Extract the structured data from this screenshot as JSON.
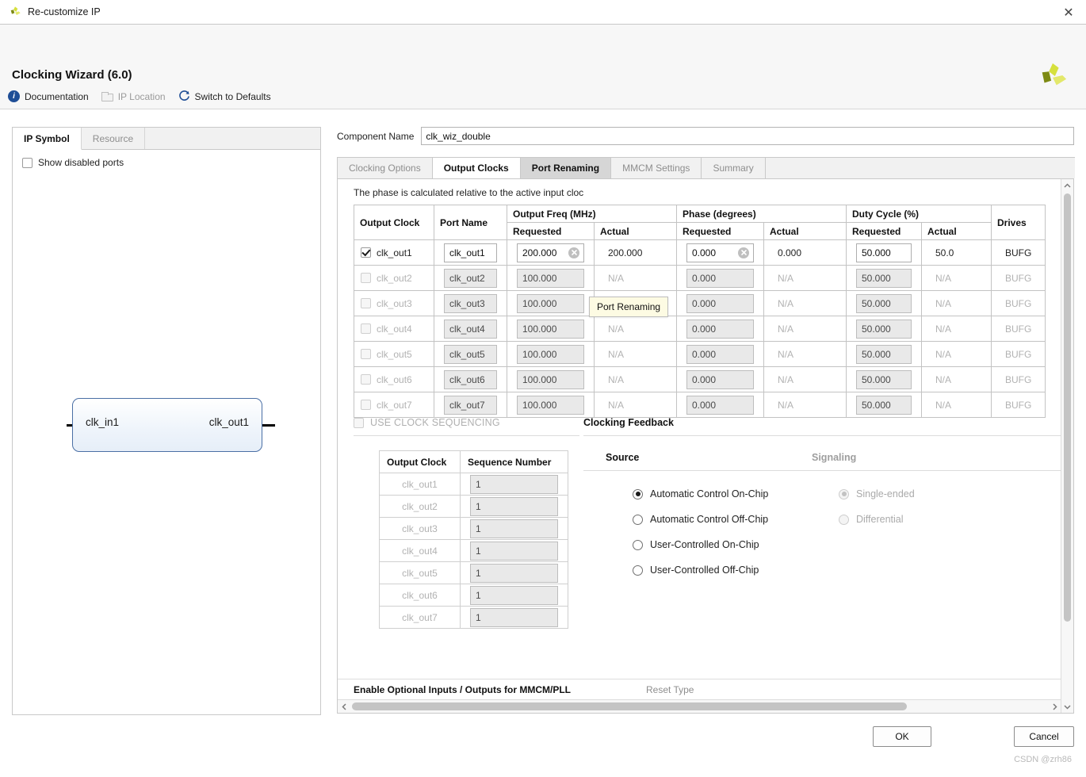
{
  "window": {
    "title": "Re-customize IP",
    "close_label": "✕"
  },
  "header": {
    "title": "Clocking Wizard (6.0)",
    "links": [
      {
        "label": "Documentation",
        "icon": "info-icon",
        "enabled": true
      },
      {
        "label": "IP Location",
        "icon": "folder-icon",
        "enabled": false
      },
      {
        "label": "Switch to Defaults",
        "icon": "refresh-icon",
        "enabled": true
      }
    ],
    "logo": "xilinx-logo"
  },
  "left_panel": {
    "tabs": [
      {
        "label": "IP Symbol",
        "active": true
      },
      {
        "label": "Resource",
        "active": false
      }
    ],
    "show_disabled_ports": {
      "label": "Show disabled ports",
      "checked": false
    },
    "symbol": {
      "input_port": "clk_in1",
      "output_port": "clk_out1"
    }
  },
  "component": {
    "label": "Component Name",
    "value": "clk_wiz_double"
  },
  "tabs": [
    {
      "label": "Clocking Options",
      "state": "inactive"
    },
    {
      "label": "Output Clocks",
      "state": "active"
    },
    {
      "label": "Port Renaming",
      "state": "hover"
    },
    {
      "label": "MMCM Settings",
      "state": "inactive"
    },
    {
      "label": "Summary",
      "state": "inactive"
    }
  ],
  "tooltip": {
    "text": "Port Renaming"
  },
  "note": "The phase is calculated relative to the active input cloc",
  "clock_table": {
    "group_headers": [
      {
        "label": "Output Clock",
        "rowspan": 2
      },
      {
        "label": "Port Name",
        "rowspan": 2
      },
      {
        "label": "Output Freq (MHz)",
        "colspan": 2
      },
      {
        "label": "Phase (degrees)",
        "colspan": 2
      },
      {
        "label": "Duty Cycle (%)",
        "colspan": 2
      },
      {
        "label": "Drives",
        "rowspan": 2
      }
    ],
    "sub_headers": [
      "Requested",
      "Actual",
      "Requested",
      "Actual",
      "Requested",
      "Actual"
    ],
    "rows": [
      {
        "name": "clk_out1",
        "checked": true,
        "enabled": true,
        "port_name": "clk_out1",
        "freq_requested": "200.000",
        "freq_actual": "200.000",
        "phase_requested": "0.000",
        "phase_actual": "0.000",
        "duty_requested": "50.000",
        "duty_actual": "50.0",
        "drives": "BUFG",
        "clear_icons": [
          "freq",
          "phase"
        ]
      },
      {
        "name": "clk_out2",
        "checked": false,
        "enabled": false,
        "port_name": "clk_out2",
        "freq_requested": "100.000",
        "freq_actual": "N/A",
        "phase_requested": "0.000",
        "phase_actual": "N/A",
        "duty_requested": "50.000",
        "duty_actual": "N/A",
        "drives": "BUFG",
        "clear_icons": []
      },
      {
        "name": "clk_out3",
        "checked": false,
        "enabled": false,
        "port_name": "clk_out3",
        "freq_requested": "100.000",
        "freq_actual": "N/A",
        "phase_requested": "0.000",
        "phase_actual": "N/A",
        "duty_requested": "50.000",
        "duty_actual": "N/A",
        "drives": "BUFG",
        "clear_icons": []
      },
      {
        "name": "clk_out4",
        "checked": false,
        "enabled": false,
        "port_name": "clk_out4",
        "freq_requested": "100.000",
        "freq_actual": "N/A",
        "phase_requested": "0.000",
        "phase_actual": "N/A",
        "duty_requested": "50.000",
        "duty_actual": "N/A",
        "drives": "BUFG",
        "clear_icons": []
      },
      {
        "name": "clk_out5",
        "checked": false,
        "enabled": false,
        "port_name": "clk_out5",
        "freq_requested": "100.000",
        "freq_actual": "N/A",
        "phase_requested": "0.000",
        "phase_actual": "N/A",
        "duty_requested": "50.000",
        "duty_actual": "N/A",
        "drives": "BUFG",
        "clear_icons": []
      },
      {
        "name": "clk_out6",
        "checked": false,
        "enabled": false,
        "port_name": "clk_out6",
        "freq_requested": "100.000",
        "freq_actual": "N/A",
        "phase_requested": "0.000",
        "phase_actual": "N/A",
        "duty_requested": "50.000",
        "duty_actual": "N/A",
        "drives": "BUFG",
        "clear_icons": []
      },
      {
        "name": "clk_out7",
        "checked": false,
        "enabled": false,
        "port_name": "clk_out7",
        "freq_requested": "100.000",
        "freq_actual": "N/A",
        "phase_requested": "0.000",
        "phase_actual": "N/A",
        "duty_requested": "50.000",
        "duty_actual": "N/A",
        "drives": "BUFG",
        "clear_icons": []
      }
    ]
  },
  "sequencing": {
    "checkbox_label": "USE CLOCK SEQUENCING",
    "checked": false,
    "enabled": false,
    "headers": [
      "Output Clock",
      "Sequence Number"
    ],
    "rows": [
      {
        "clock": "clk_out1",
        "sequence": "1"
      },
      {
        "clock": "clk_out2",
        "sequence": "1"
      },
      {
        "clock": "clk_out3",
        "sequence": "1"
      },
      {
        "clock": "clk_out4",
        "sequence": "1"
      },
      {
        "clock": "clk_out5",
        "sequence": "1"
      },
      {
        "clock": "clk_out6",
        "sequence": "1"
      },
      {
        "clock": "clk_out7",
        "sequence": "1"
      }
    ]
  },
  "feedback": {
    "title": "Clocking Feedback",
    "source": {
      "label": "Source",
      "enabled": true,
      "options": [
        {
          "label": "Automatic Control On-Chip",
          "selected": true
        },
        {
          "label": "Automatic Control Off-Chip",
          "selected": false
        },
        {
          "label": "User-Controlled On-Chip",
          "selected": false
        },
        {
          "label": "User-Controlled Off-Chip",
          "selected": false
        }
      ]
    },
    "signaling": {
      "label": "Signaling",
      "enabled": false,
      "options": [
        {
          "label": "Single-ended",
          "selected": true
        },
        {
          "label": "Differential",
          "selected": false
        }
      ]
    }
  },
  "bottom_sections": {
    "left": "Enable Optional Inputs / Outputs for MMCM/PLL",
    "right": "Reset Type"
  },
  "footer": {
    "ok_label": "OK",
    "cancel_label": "Cancel",
    "watermark": "CSDN @zrh86"
  }
}
